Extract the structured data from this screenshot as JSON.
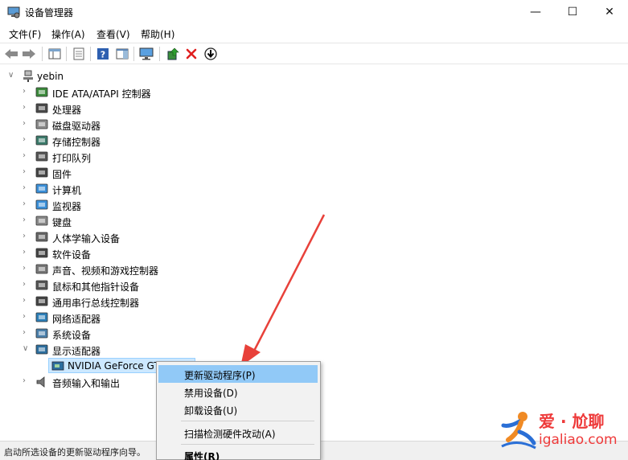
{
  "window": {
    "title": "设备管理器",
    "controls": [
      "—",
      "☐",
      "✕"
    ]
  },
  "menu": [
    "文件(F)",
    "操作(A)",
    "查看(V)",
    "帮助(H)"
  ],
  "tree": {
    "root": "yebin",
    "items": [
      "IDE ATA/ATAPI 控制器",
      "处理器",
      "磁盘驱动器",
      "存储控制器",
      "打印队列",
      "固件",
      "计算机",
      "监视器",
      "键盘",
      "人体学输入设备",
      "软件设备",
      "声音、视频和游戏控制器",
      "鼠标和其他指针设备",
      "通用串行总线控制器",
      "网络适配器",
      "系统设备",
      "显示适配器"
    ],
    "display_child": "NVIDIA GeForce GT",
    "last_item": "音频输入和输出"
  },
  "context_menu": {
    "update_driver": "更新驱动程序(P)",
    "disable": "禁用设备(D)",
    "uninstall": "卸载设备(U)",
    "scan": "扫描检测硬件改动(A)",
    "properties": "属性(R)"
  },
  "status": "启动所选设备的更新驱动程序向导。",
  "watermark": {
    "brand": "爱 · 尬聊",
    "domain": "igaliao.com"
  },
  "colors": {
    "selection": "#cce8ff",
    "menu_highlight": "#91c9f7",
    "arrow": "#e8413a",
    "delete": "#e02020"
  }
}
